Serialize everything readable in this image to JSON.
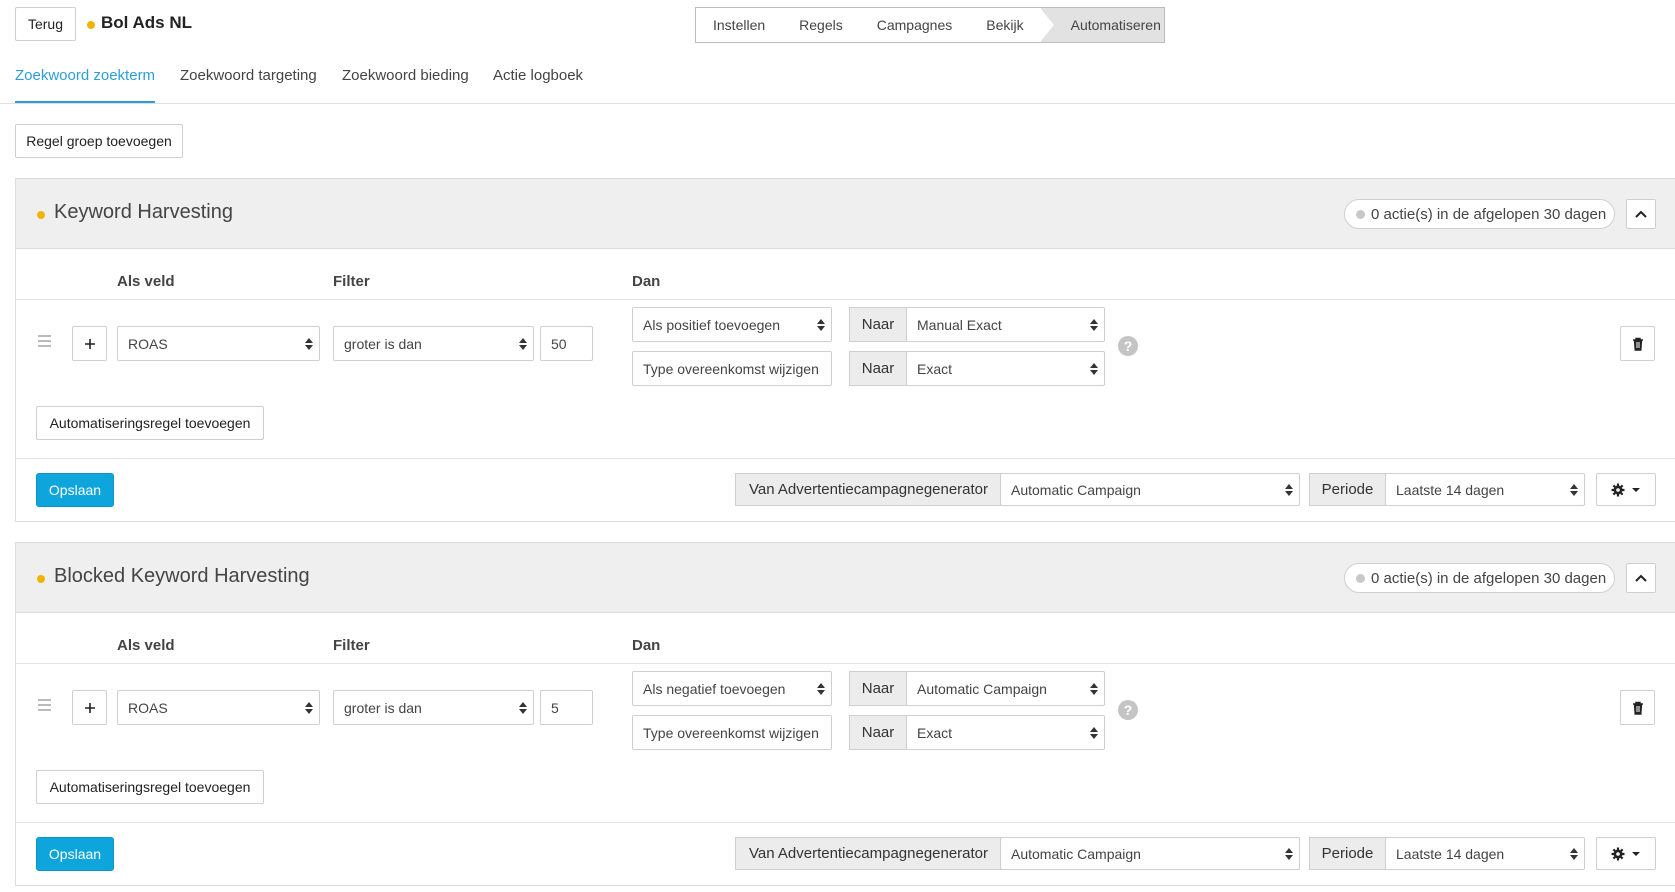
{
  "header": {
    "back_label": "Terug",
    "account_name": "Bol Ads NL",
    "steps": [
      "Instellen",
      "Regels",
      "Campagnes",
      "Bekijk",
      "Automatiseren"
    ]
  },
  "tabs": [
    "Zoekwoord zoekterm",
    "Zoekwoord targeting",
    "Zoekwoord bieding",
    "Actie logboek"
  ],
  "add_group_label": "Regel groep toevoegen",
  "columns": {
    "field": "Als veld",
    "filter": "Filter",
    "then": "Dan"
  },
  "groups": [
    {
      "title": "Keyword Harvesting",
      "actions_pill": "0 actie(s) in de afgelopen 30 dagen",
      "rule": {
        "field": "ROAS",
        "filter": "groter is dan",
        "value": "50",
        "action1": "Als positief toevoegen",
        "action1_target": "Manual Exact",
        "action2": "Type overeenkomst wijzigen",
        "action2_target": "Exact"
      },
      "add_rule_label": "Automatiseringsregel toevoegen",
      "save_label": "Opslaan",
      "source_label": "Van Advertentiecampagnegenerator",
      "source_value": "Automatic Campaign",
      "period_label": "Periode",
      "period_value": "Laatste 14 dagen"
    },
    {
      "title": "Blocked Keyword Harvesting",
      "actions_pill": "0 actie(s) in de afgelopen 30 dagen",
      "rule": {
        "field": "ROAS",
        "filter": "groter is dan",
        "value": "5",
        "action1": "Als negatief toevoegen",
        "action1_target": "Automatic Campaign",
        "action2": "Type overeenkomst wijzigen",
        "action2_target": "Exact"
      },
      "add_rule_label": "Automatiseringsregel toevoegen",
      "save_label": "Opslaan",
      "source_label": "Van Advertentiecampagnegenerator",
      "source_value": "Automatic Campaign",
      "period_label": "Periode",
      "period_value": "Laatste 14 dagen"
    }
  ],
  "naar_label": "Naar",
  "help_symbol": "?",
  "icons": {
    "plus": "plus-icon",
    "trash": "trash-icon",
    "gear": "gear-icon",
    "chevron": "chevron-up-icon",
    "drag": "drag-handle-icon"
  },
  "colors": {
    "primary": "#0ea5dc",
    "tab_active": "#2a9fd6",
    "status_dot": "#f0b400",
    "header_bg": "#efefef"
  }
}
